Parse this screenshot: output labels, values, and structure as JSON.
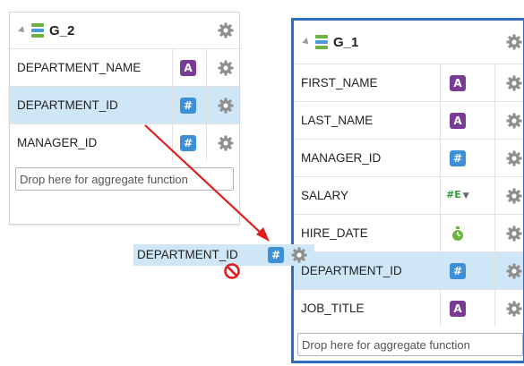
{
  "g2": {
    "title": "G_2",
    "rows": [
      {
        "label": "DEPARTMENT_NAME",
        "type": "A"
      },
      {
        "label": "DEPARTMENT_ID",
        "type": "#"
      },
      {
        "label": "MANAGER_ID",
        "type": "#"
      }
    ],
    "drop_placeholder": "Drop here for aggregate function"
  },
  "g1": {
    "title": "G_1",
    "rows": [
      {
        "label": "FIRST_NAME",
        "type": "A"
      },
      {
        "label": "LAST_NAME",
        "type": "A"
      },
      {
        "label": "MANAGER_ID",
        "type": "#"
      },
      {
        "label": "SALARY",
        "type": "#E"
      },
      {
        "label": "HIRE_DATE",
        "type": "date"
      },
      {
        "label": "DEPARTMENT_ID",
        "type": "#"
      },
      {
        "label": "JOB_TITLE",
        "type": "A"
      }
    ],
    "drop_placeholder": "Drop here for aggregate function"
  },
  "drag": {
    "label": "DEPARTMENT_ID",
    "type": "#"
  },
  "colors": {
    "accent": "#2f6cbf",
    "selected": "#cfe6f7",
    "arrow": "#e01e1e",
    "alpha_badge": "#7a3b96",
    "num_badge": "#3d8fd6"
  }
}
